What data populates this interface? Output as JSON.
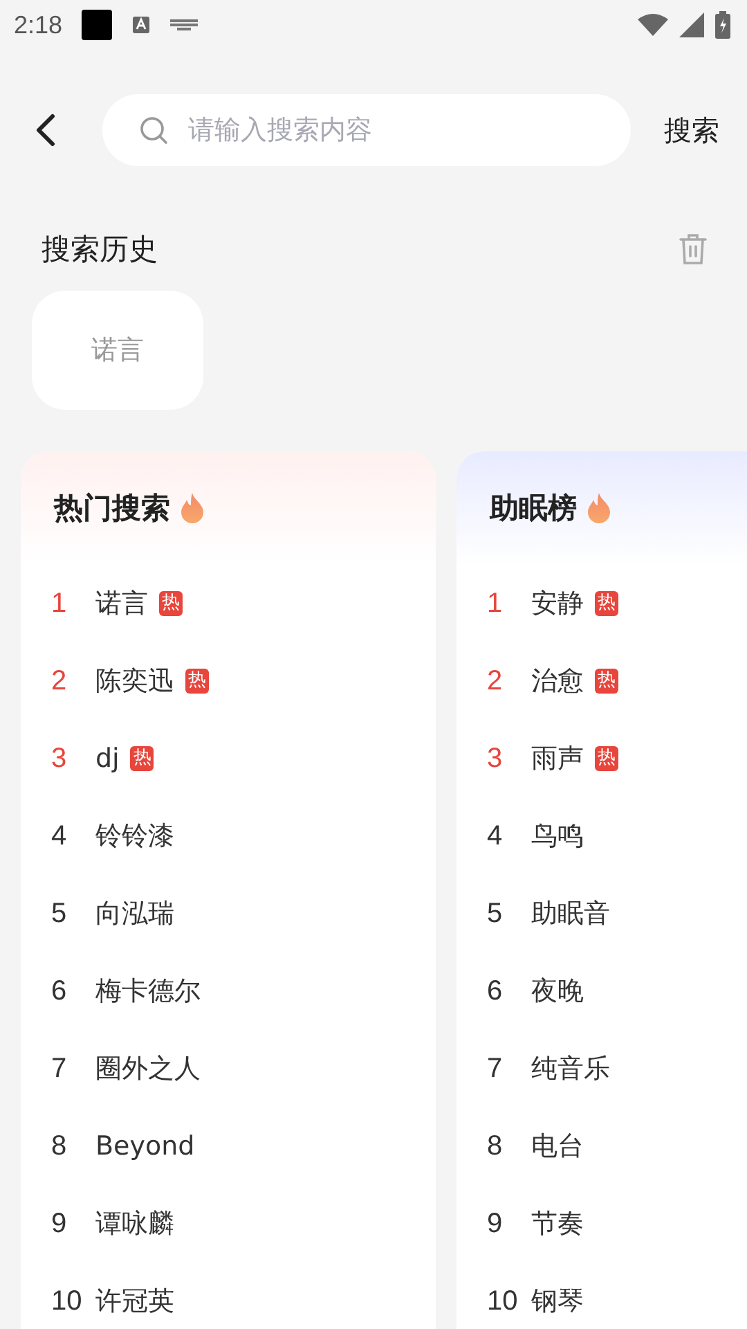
{
  "status_bar": {
    "time": "2:18"
  },
  "search": {
    "placeholder": "请输入搜索内容",
    "button": "搜索"
  },
  "history": {
    "title": "搜索历史",
    "items": [
      "诺言"
    ]
  },
  "boards": [
    {
      "title": "热门搜索",
      "kind": "hot",
      "items": [
        {
          "rank": "1",
          "name": "诺言",
          "highlighted": true,
          "badge": "热"
        },
        {
          "rank": "2",
          "name": "陈奕迅",
          "highlighted": true,
          "badge": "热"
        },
        {
          "rank": "3",
          "name": "dj",
          "highlighted": true,
          "badge": "热"
        },
        {
          "rank": "4",
          "name": "铃铃漆",
          "highlighted": false
        },
        {
          "rank": "5",
          "name": "向泓瑞",
          "highlighted": false
        },
        {
          "rank": "6",
          "name": "梅卡德尔",
          "highlighted": false
        },
        {
          "rank": "7",
          "name": "圈外之人",
          "highlighted": false
        },
        {
          "rank": "8",
          "name": "Beyond",
          "highlighted": false
        },
        {
          "rank": "9",
          "name": "谭咏麟",
          "highlighted": false
        },
        {
          "rank": "10",
          "name": "许冠英",
          "highlighted": false
        }
      ]
    },
    {
      "title": "助眠榜",
      "kind": "sleep",
      "items": [
        {
          "rank": "1",
          "name": "安静",
          "highlighted": true,
          "badge": "热"
        },
        {
          "rank": "2",
          "name": "治愈",
          "highlighted": true,
          "badge": "热"
        },
        {
          "rank": "3",
          "name": "雨声",
          "highlighted": true,
          "badge": "热"
        },
        {
          "rank": "4",
          "name": "鸟鸣",
          "highlighted": false
        },
        {
          "rank": "5",
          "name": "助眠音",
          "highlighted": false
        },
        {
          "rank": "6",
          "name": "夜晚",
          "highlighted": false
        },
        {
          "rank": "7",
          "name": "纯音乐",
          "highlighted": false
        },
        {
          "rank": "8",
          "name": "电台",
          "highlighted": false
        },
        {
          "rank": "9",
          "name": "节奏",
          "highlighted": false
        },
        {
          "rank": "10",
          "name": "钢琴",
          "highlighted": false
        }
      ]
    }
  ]
}
